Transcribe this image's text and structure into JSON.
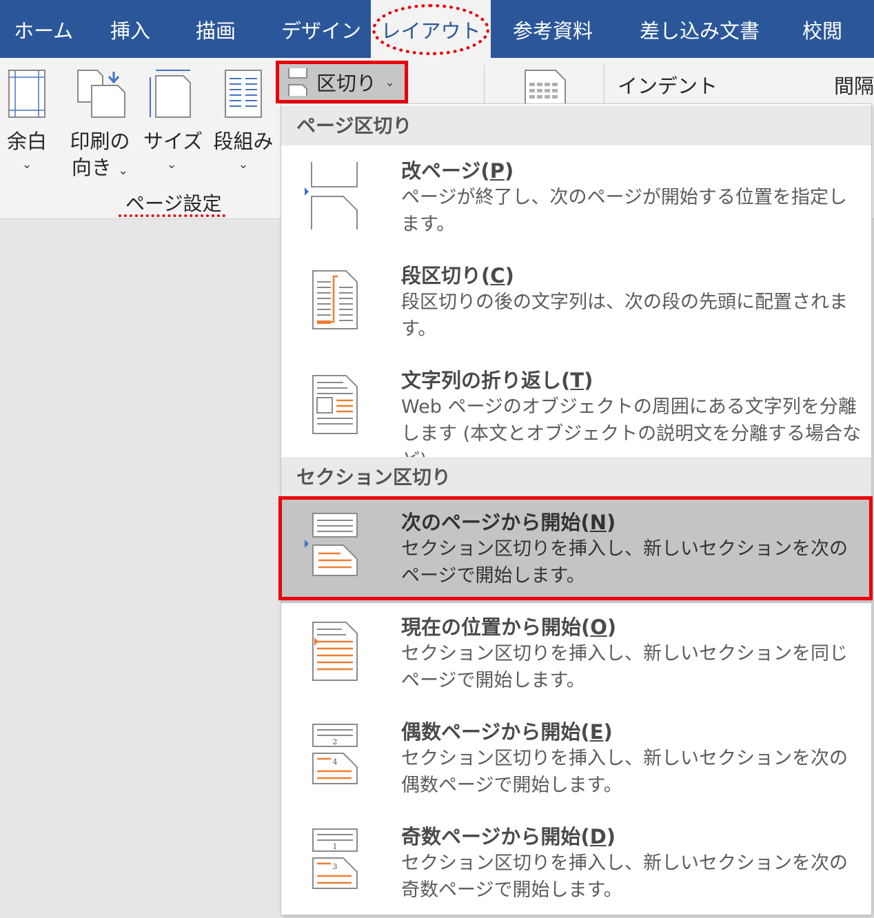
{
  "tabs": [
    "ホーム",
    "挿入",
    "描画",
    "デザイン",
    "レイアウト",
    "参考資料",
    "差し込み文書",
    "校閲"
  ],
  "ribbon": {
    "margins_label": "余白",
    "orientation_label_1": "印刷の",
    "orientation_label_2": "向き",
    "size_label": "サイズ",
    "columns_label": "段組み",
    "group_label": "ページ設定",
    "breaks_label": "区切り",
    "indent_label": "インデント",
    "spacing_label": "間隔",
    "chevron": "⌄"
  },
  "menu": {
    "page_breaks_header": "ページ区切り",
    "section_breaks_header": "セクション区切り",
    "items": [
      {
        "title_pre": "改ページ(",
        "key": "P",
        "title_post": ")",
        "desc": "ページが終了し、次のページが開始する位置を指定します。"
      },
      {
        "title_pre": "段区切り(",
        "key": "C",
        "title_post": ")",
        "desc": "段区切りの後の文字列は、次の段の先頭に配置されます。"
      },
      {
        "title_pre": "文字列の折り返し(",
        "key": "T",
        "title_post": ")",
        "desc": "Web ページのオブジェクトの周囲にある文字列を分離します (本文とオブジェクトの説明文を分離する場合など)。"
      },
      {
        "title_pre": "次のページから開始(",
        "key": "N",
        "title_post": ")",
        "desc": "セクション区切りを挿入し、新しいセクションを次のページで開始します。"
      },
      {
        "title_pre": "現在の位置から開始(",
        "key": "O",
        "title_post": ")",
        "desc": "セクション区切りを挿入し、新しいセクションを同じページで開始します。"
      },
      {
        "title_pre": "偶数ページから開始(",
        "key": "E",
        "title_post": ")",
        "desc": "セクション区切りを挿入し、新しいセクションを次の偶数ページで開始します。"
      },
      {
        "title_pre": "奇数ページから開始(",
        "key": "D",
        "title_post": ")",
        "desc": "セクション区切りを挿入し、新しいセクションを次の奇数ページで開始します。"
      }
    ],
    "even_icon_nums": [
      "2",
      "4"
    ],
    "odd_icon_nums": [
      "1",
      "3"
    ]
  },
  "colors": {
    "accent": "#2b579a",
    "highlight": "#e8000b",
    "icon_orange": "#ed7d31",
    "icon_blue": "#4472c4"
  }
}
